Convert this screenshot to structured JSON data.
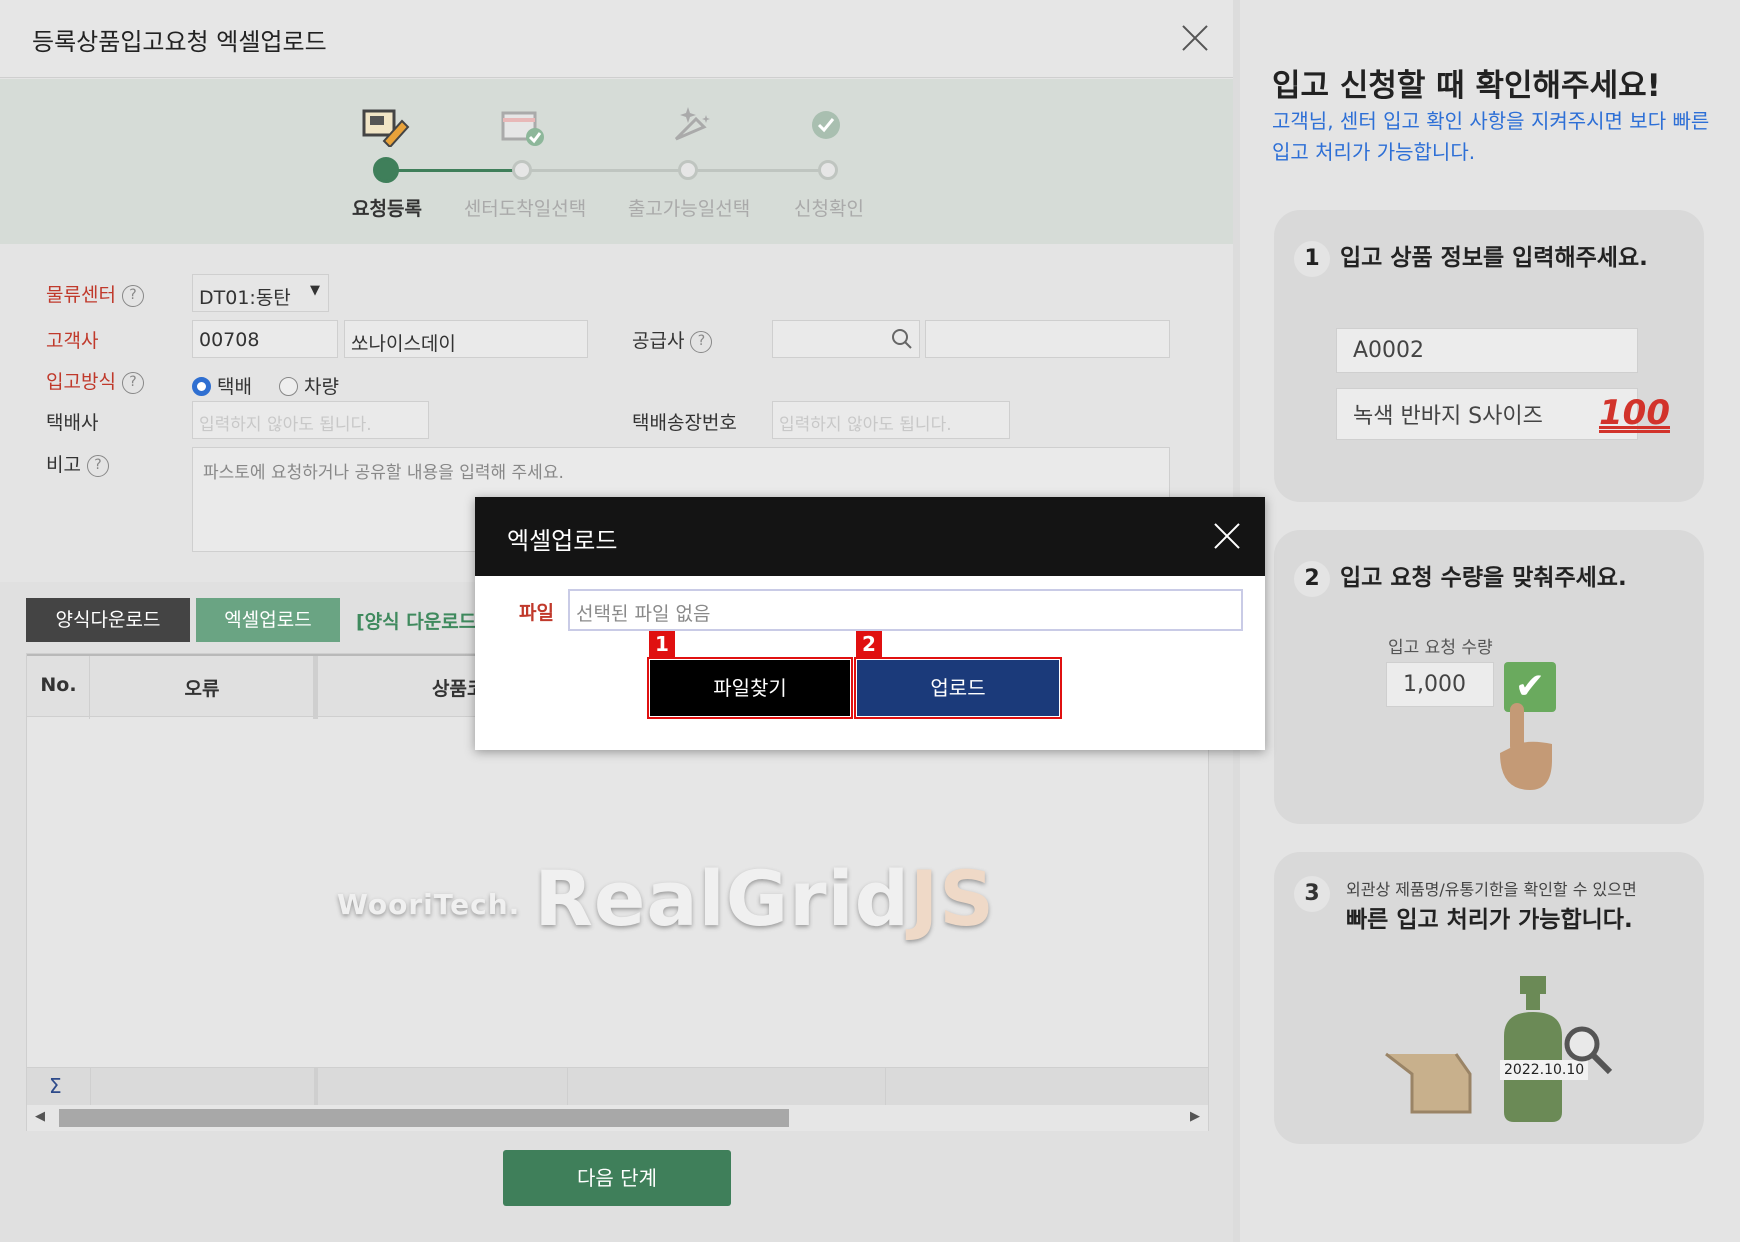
{
  "window": {
    "title": "등록상품입고요청 엑셀업로드"
  },
  "steps": [
    {
      "label": "요청등록",
      "state": "active"
    },
    {
      "label": "센터도착일선택",
      "state": "pending"
    },
    {
      "label": "출고가능일선택",
      "state": "pending"
    },
    {
      "label": "신청확인",
      "state": "pending"
    }
  ],
  "form": {
    "center_label": "물류센터",
    "center_value": "DT01:동탄",
    "customer_label": "고객사",
    "customer_code": "00708",
    "customer_name": "쏘나이스데이",
    "supplier_label": "공급사",
    "method_label": "입고방식",
    "method_options": [
      "택배",
      "차량"
    ],
    "method_selected": "택배",
    "courier_label": "택배사",
    "courier_placeholder": "입력하지 않아도 됩니다.",
    "tracking_label": "택배송장번호",
    "tracking_placeholder": "입력하지 않아도 됩니다.",
    "memo_label": "비고",
    "memo_placeholder": "파스토에 요청하거나 공유할 내용을 입력해 주세요.",
    "help_glyph": "?"
  },
  "toolbar": {
    "template_download": "양식다운로드",
    "excel_upload": "엑셀업로드",
    "link_text": "[양식 다운로드"
  },
  "grid": {
    "columns": [
      "No.",
      "오류",
      "상품코드"
    ],
    "footer_symbol": "Σ",
    "watermark_brand": "WooriTech.",
    "watermark_main": "RealGrid",
    "watermark_js": "JS"
  },
  "next_button": "다음 단계",
  "info": {
    "title": "입고 신청할 때 확인해주세요!",
    "subtitle": "고객님, 센터 입고 확인 사항을 지켜주시면 보다 빠른 입고 처리가 가능합니다.",
    "card1": {
      "num": "1",
      "heading": "입고 상품 정보를 입력해주세요.",
      "code": "A0002",
      "name": "녹색 반바지 S사이즈",
      "emoji": "100"
    },
    "card2": {
      "num": "2",
      "heading": "입고 요청 수량을 맞춰주세요.",
      "qty_label": "입고 요청 수량",
      "qty": "1,000"
    },
    "card3": {
      "num": "3",
      "small": "외관상 제품명/유통기한을 확인할 수 있으면",
      "heading": "빠른 입고 처리가 가능합니다.",
      "date": "2022.10.10"
    }
  },
  "modal": {
    "title": "엑셀업로드",
    "file_label": "파일",
    "file_value": "선택된 파일 없음",
    "browse_button": "파일찾기",
    "upload_button": "업로드",
    "badge1": "1",
    "badge2": "2"
  },
  "colors": {
    "accent": "#3f7f5a",
    "required": "#c0392b",
    "upload": "#1b3a7a",
    "highlight": "#e01010"
  }
}
